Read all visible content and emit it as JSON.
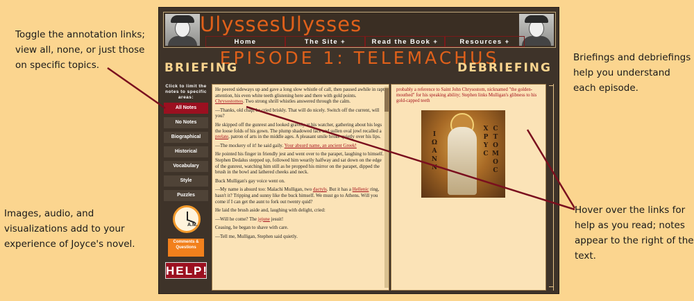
{
  "annotations": {
    "top_left": "Toggle the annotation links; view all, none, or just those on specific topics.",
    "bottom_left": "Images, audio, and visualizations add to your experience of Joyce's novel.",
    "top_right": "Briefings and debriefings help you understand each episode.",
    "bottom_right": "Hover over the links for help as you read; notes appear to the right of the text."
  },
  "header": {
    "logo": "UlyssesUlysses",
    "nav": [
      "Home",
      "The Site +",
      "Read the Book +",
      "Resources +"
    ]
  },
  "episode": {
    "title": "EPISODE 1: TELEMACHUS",
    "briefing": "BRIEFING",
    "debriefing": "DEBRIEFING"
  },
  "sidebar": {
    "heading": "Click to limit the notes to specific areas:",
    "buttons": [
      "All Notes",
      "No Notes",
      "Biographical",
      "Historical",
      "Vocabulary",
      "Style",
      "Puzzles"
    ],
    "clock_label": "A.M.",
    "comments": "Comments & Questions",
    "help": "HELP!"
  },
  "text": {
    "p1a": "He peered sideways up and gave a long slow whistle of call, then paused awhile in rapt attention, his even white teeth glistening here and there with gold points.",
    "p1link": "Chrysostomos",
    "p1b": ". Two strong shrill whistles answered through the calm.",
    "p2": "—Thanks, old chap, he cried briskly. That will do nicely. Switch off the current, will you?",
    "p3a": "He skipped off the gunrest and looked gravely at his watcher, gathering about his legs the loose folds of his gown. The plump shadowed face and sullen oval jowl recalled a",
    "p3link": "prelate",
    "p3b": ", patron of arts in the middle ages. A pleasant smile broke quietly over his lips.",
    "p4a": "—The mockery of it! he said gaily.",
    "p4link": "Your absurd name, an ancient Greek!",
    "p5": "He pointed his finger in friendly jest and went over to the parapet, laughing to himself. Stephen Dedalus stepped up, followed him wearily halfway and sat down on the edge of the gunrest, watching him still as he propped his mirror on the parapet, dipped the brush in the bowl and lathered cheeks and neck.",
    "p6": "Buck Mulligan's gay voice went on.",
    "p7a": "—My name is absurd too: Malachi Mulligan, two",
    "p7link1": "dactyls",
    "p7b": ". But it has a",
    "p7link2": "Hellenic",
    "p7c": "ring, hasn't it? Tripping and sunny like the buck himself. We must go to Athens. Will you come if I can get the aunt to fork out twenty quid?",
    "p8": "He laid the brush aside and, laughing with delight, cried:",
    "p9a": "—Will he come? The",
    "p9link": "jejune",
    "p9b": "jesuit!",
    "p10": "Ceasing, he began to shave with care.",
    "p11": "—Tell me, Mulligan, Stephen said quietly."
  },
  "note": {
    "text": "probably a reference to Saint John Chrysostom, nicknamed \"the golden-mouthed\" for his speaking ability; Stephen links Mulligan's glibness to his gold-capped teeth"
  },
  "image": {
    "left_glyphs": [
      "I",
      "Ω",
      "Α",
      "Ν",
      "Ν"
    ],
    "right_glyphs_1": [
      "Χ",
      "Ρ",
      "Υ",
      "Ϲ"
    ],
    "right_glyphs_2": [
      "Ϲ",
      "Τ",
      "Ο",
      "Μ",
      "Ο",
      "Ϲ"
    ]
  },
  "colors": {
    "page_bg": "#fbd58f",
    "frame_bg": "#3e3329",
    "accent_orange": "#e0601a",
    "link_red": "#a40f1b",
    "active_btn": "#9b1020",
    "callout_line": "#7a0f1e"
  }
}
